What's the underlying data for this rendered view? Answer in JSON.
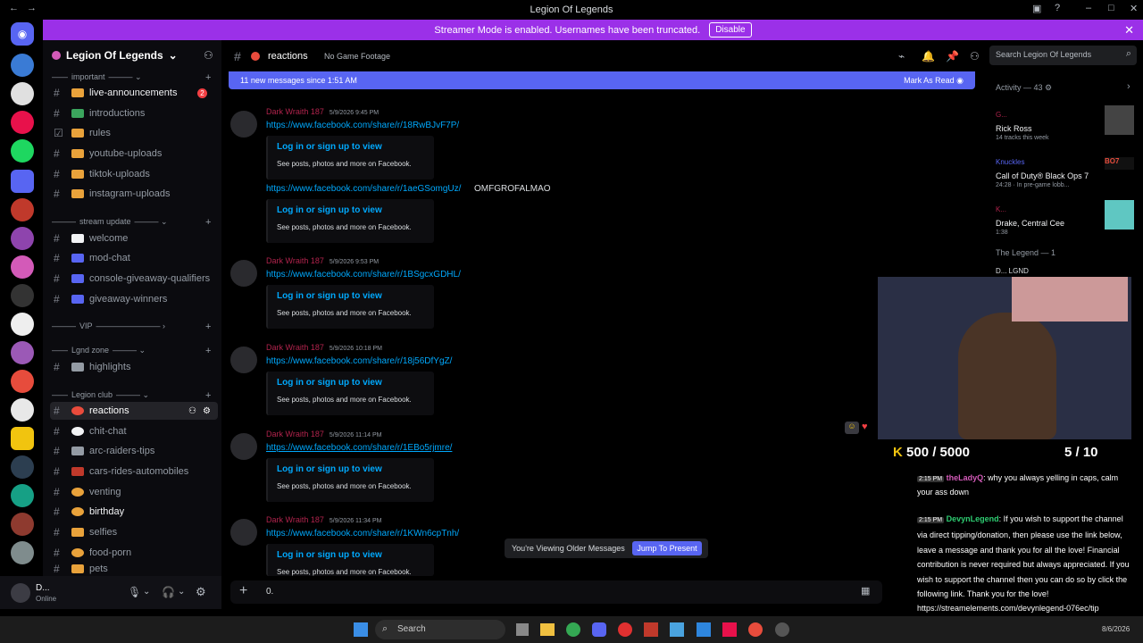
{
  "window": {
    "title": "Legion Of Legends"
  },
  "banner": {
    "text": "Streamer Mode is enabled. Usernames have been truncated.",
    "button": "Disable"
  },
  "server": {
    "name": "Legion Of Legends",
    "categories": [
      {
        "name": "important",
        "channels": [
          "live-announcements",
          "introductions",
          "rules",
          "youtube-uploads",
          "tiktok-uploads",
          "instagram-uploads"
        ]
      },
      {
        "name": "stream update",
        "channels": [
          "welcome",
          "mod-chat",
          "console-giveaway-qualifiers",
          "giveaway-winners"
        ]
      },
      {
        "name": "VIP",
        "channels": []
      },
      {
        "name": "Lgnd zone",
        "channels": [
          "highlights"
        ]
      },
      {
        "name": "Legion club",
        "channels": [
          "reactions",
          "chit-chat",
          "arc-raiders-tips",
          "cars-rides-automobiles",
          "venting",
          "birthday",
          "selfies",
          "food-porn",
          "pets"
        ]
      }
    ],
    "live_announcements_badge": "2"
  },
  "user": {
    "name": "D...",
    "status": "Online"
  },
  "channel": {
    "name": "reactions",
    "topic": "No Game Footage",
    "search_placeholder": "Search Legion Of Legends"
  },
  "newbar": {
    "text": "11 new messages since 1:51 AM",
    "action": "Mark As Read"
  },
  "messages": [
    {
      "author": "Dark Wraith 187",
      "time": "5/9/2026 9:45 PM",
      "link": "https://www.facebook.com/share/r/18RwBJvF7P/",
      "embed_title": "Log in or sign up to view",
      "embed_desc": "See posts, photos and more on Facebook."
    },
    {
      "author": "",
      "time": "",
      "link": "https://www.facebook.com/share/r/1aeGSomgUz/",
      "extra": "OMFGROFALMAO",
      "embed_title": "Log in or sign up to view",
      "embed_desc": "See posts, photos and more on Facebook."
    },
    {
      "author": "Dark Wraith 187",
      "time": "5/9/2026 9:53 PM",
      "link": "https://www.facebook.com/share/r/1BSgcxGDHL/",
      "embed_title": "Log in or sign up to view",
      "embed_desc": "See posts, photos and more on Facebook."
    },
    {
      "author": "Dark Wraith 187",
      "time": "5/9/2026 10:18 PM",
      "link": "https://www.facebook.com/share/r/18j56DfYgZ/",
      "embed_title": "Log in or sign up to view",
      "embed_desc": "See posts, photos and more on Facebook."
    },
    {
      "author": "Dark Wraith 187",
      "time": "5/9/2026 11:14 PM",
      "link": "https://www.facebook.com/share/r/1EBo5rjmre/",
      "embed_title": "Log in or sign up to view",
      "embed_desc": "See posts, photos and more on Facebook."
    },
    {
      "author": "Dark Wraith 187",
      "time": "5/9/2026 11:34 PM",
      "link": "https://www.facebook.com/share/r/1KWn6cpTnh/",
      "embed_title": "Log in or sign up to view",
      "embed_desc": "See posts, photos and more on Facebook."
    }
  ],
  "viewing_older": {
    "text": "You're Viewing Older Messages",
    "button": "Jump To Present"
  },
  "composer": {
    "value": "0."
  },
  "activity": {
    "header": "Activity — 43",
    "items": [
      {
        "name": "G...",
        "title": "Rick Ross",
        "sub": "14 tracks this week"
      },
      {
        "name": "Knuckles",
        "title": "Call of Duty® Black Ops 7",
        "sub": "24:28 · In pre-game lobb..."
      },
      {
        "name": "K...",
        "title": "Drake, Central Cee",
        "sub": "1:38"
      }
    ],
    "legend_header": "The Legend — 1",
    "legend_member": "D... LGND"
  },
  "stream_overlay": {
    "goal_left": "500 / 5000",
    "goal_right": "5 / 10",
    "chat": [
      {
        "time": "2:15 PM",
        "user": "theLadyQ",
        "text": ": why you always yelling in caps, calm your ass down"
      },
      {
        "time": "2:15 PM",
        "user": "DevynLegend",
        "text": ": If you wish to support the channel via direct tipping/donation, then please use the link below, leave a message and thank you for all the love! Financial contribution is never required but always appreciated. If you wish to support the channel then you can do so by click the following link. Thank you for the love! https://streamelements.com/devynlegend-076ec/tip"
      }
    ]
  },
  "taskbar": {
    "search": "Search",
    "date": "8/6/2026"
  }
}
